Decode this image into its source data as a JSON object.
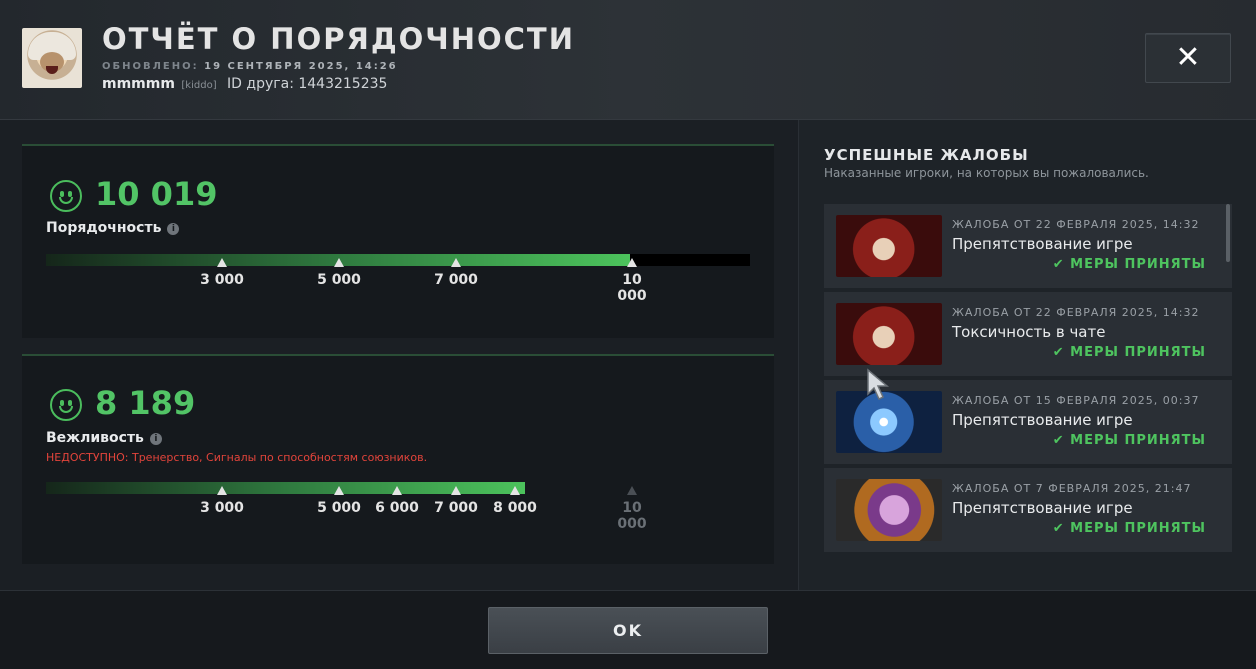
{
  "header": {
    "title": "ОТЧЁТ О ПОРЯДОЧНОСТИ",
    "updated_label": "ОБНОВЛЕНО:",
    "updated_value": "19 СЕНТЯБРЯ 2025, 14:26",
    "username": "mmmmm",
    "user_tag": "[kiddo]",
    "friend_id": "ID друга: 1443215235"
  },
  "conduct": {
    "score": "10 019",
    "label": "Порядочность",
    "progress_fraction": 0.83,
    "ticks": [
      {
        "label": "3 000",
        "reached": true
      },
      {
        "label": "5 000",
        "reached": true
      },
      {
        "label": "7 000",
        "reached": true
      },
      {
        "label": "10\n000",
        "reached": true
      }
    ]
  },
  "politeness": {
    "score": "8 189",
    "label": "Вежливость",
    "unavailable": "НЕДОСТУПНО:  Тренерство, Сигналы по способностям союзников.",
    "progress_fraction": 0.68,
    "ticks": [
      {
        "label": "3 000",
        "reached": true
      },
      {
        "label": "5 000",
        "reached": true
      },
      {
        "label": "6 000",
        "reached": true
      },
      {
        "label": "7 000",
        "reached": true
      },
      {
        "label": "8 000",
        "reached": true
      },
      {
        "label": "10\n000",
        "reached": false
      }
    ]
  },
  "reports": {
    "title": "УСПЕШНЫЕ ЖАЛОБЫ",
    "subtitle": "Наказанные игроки, на которых вы пожаловались.",
    "items": [
      {
        "date": "ЖАЛОБА ОТ 22 ФЕВРАЛЯ 2025, 14:32",
        "reason": "Препятствование игре",
        "status": "МЕРЫ ПРИНЯТЫ",
        "thumb": "red"
      },
      {
        "date": "ЖАЛОБА ОТ 22 ФЕВРАЛЯ 2025, 14:32",
        "reason": "Токсичность в чате",
        "status": "МЕРЫ ПРИНЯТЫ",
        "thumb": "red"
      },
      {
        "date": "ЖАЛОБА ОТ 15 ФЕВРАЛЯ 2025, 00:37",
        "reason": "Препятствование игре",
        "status": "МЕРЫ ПРИНЯТЫ",
        "thumb": "blue"
      },
      {
        "date": "ЖАЛОБА ОТ 7 ФЕВРАЛЯ 2025, 21:47",
        "reason": "Препятствование игре",
        "status": "МЕРЫ ПРИНЯТЫ",
        "thumb": "purple"
      }
    ]
  },
  "footer": {
    "ok_label": "OK"
  },
  "colors": {
    "accent_green": "#52c466",
    "warning_red": "#e2443b"
  },
  "icons": {
    "close": "close-icon",
    "check": "check-icon",
    "info": "info-icon",
    "smiley": "smiley-icon"
  }
}
